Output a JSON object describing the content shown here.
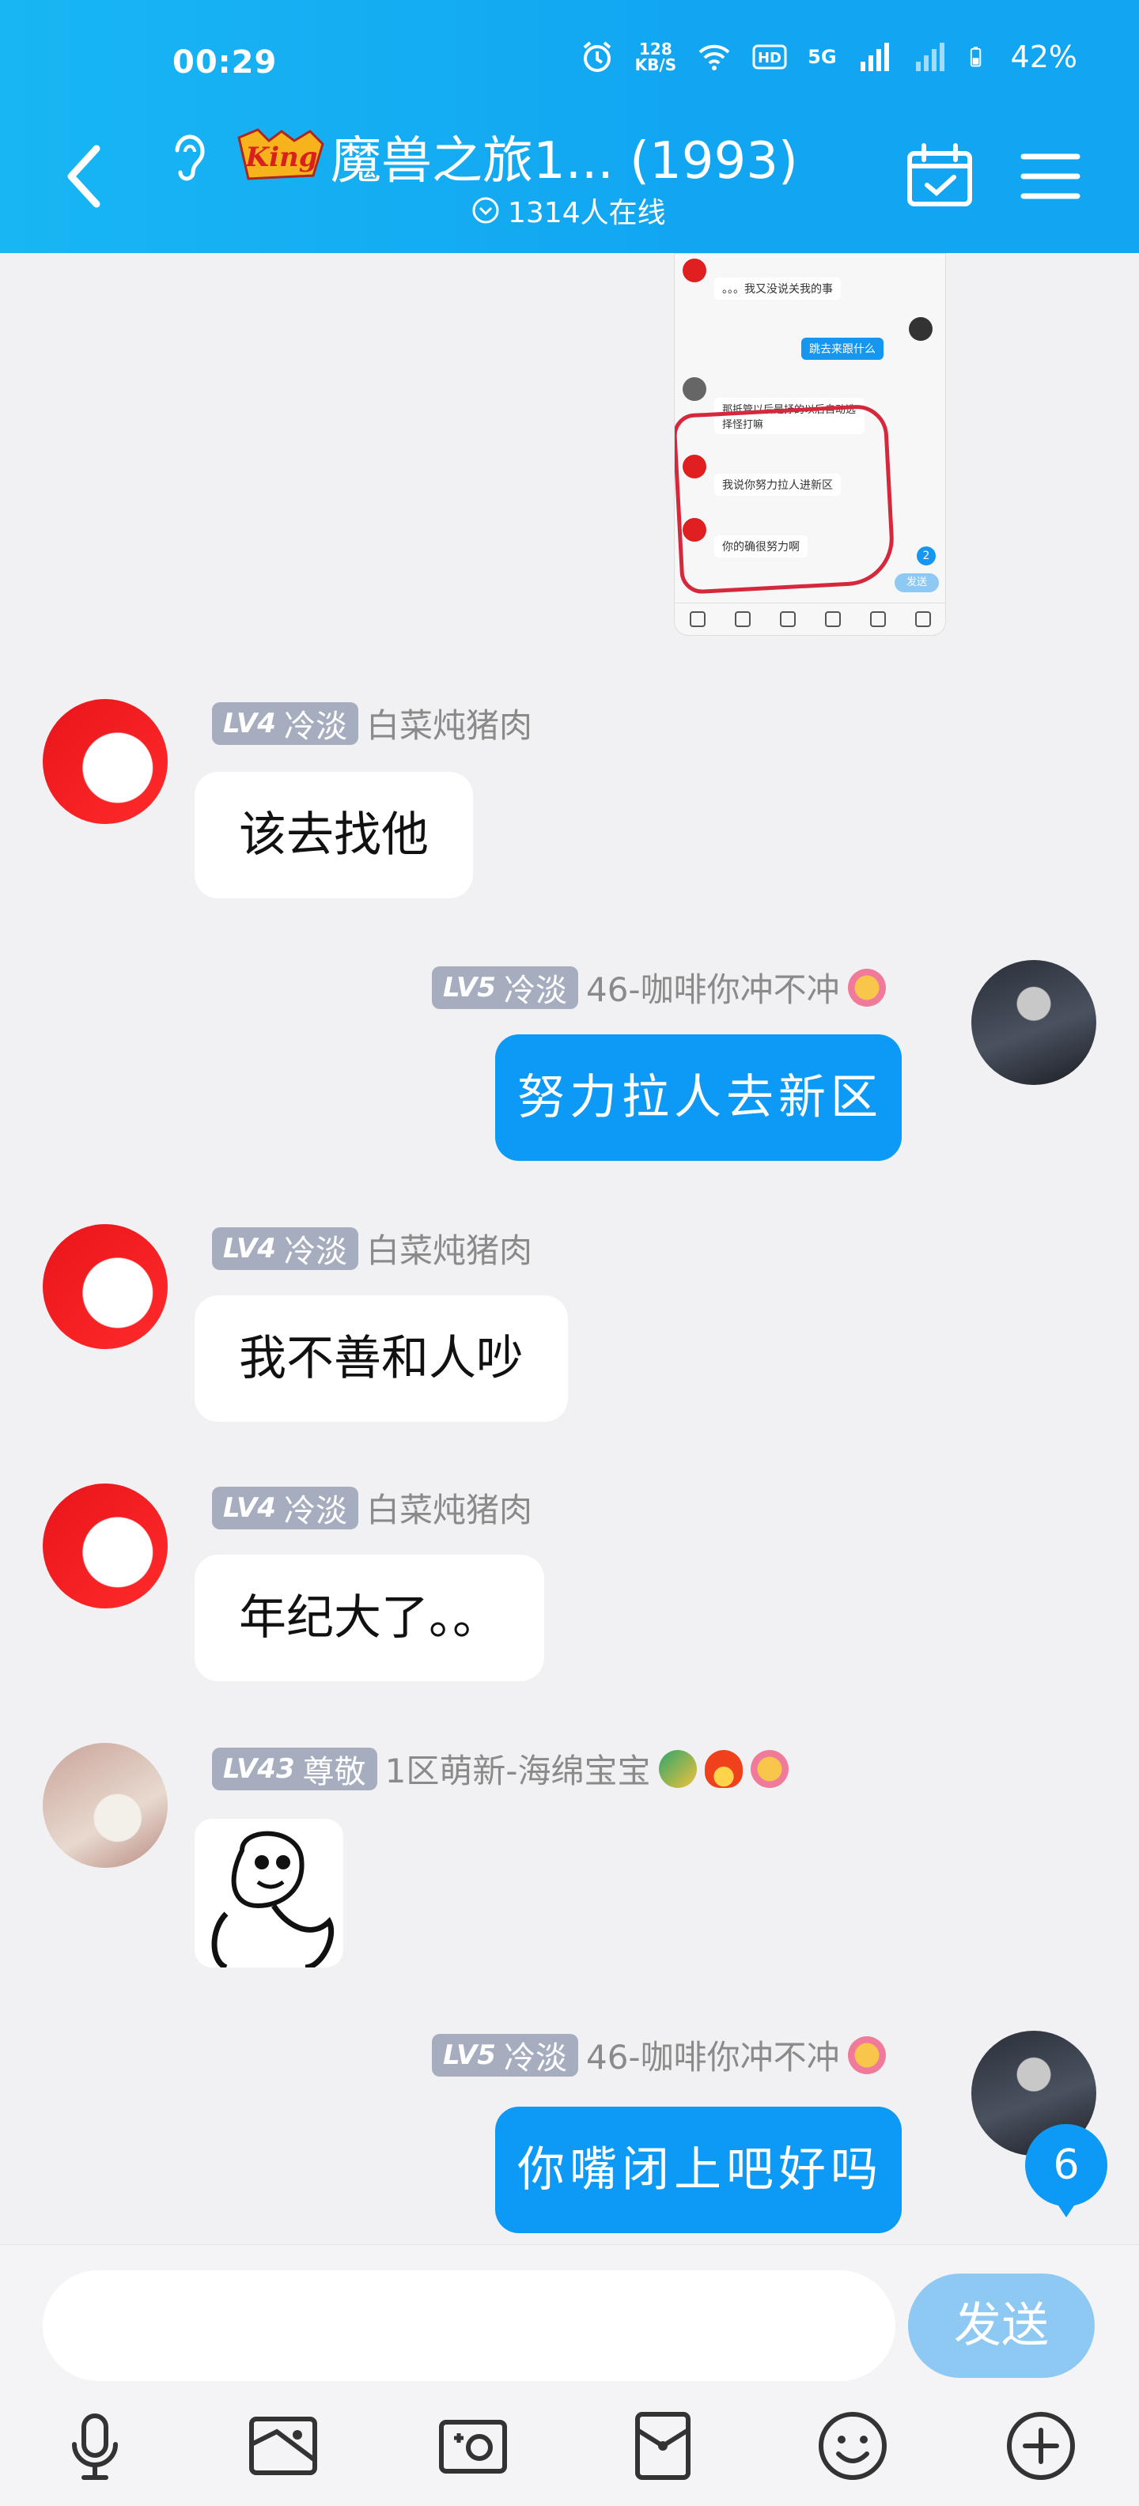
{
  "status": {
    "time": "00:29",
    "netspeed_value": "128",
    "netspeed_unit": "KB/S",
    "network": "5G",
    "battery": "42%"
  },
  "header": {
    "title": "魔兽之旅1... (1993)",
    "online": "1314人在线"
  },
  "thumbnail": {
    "lines": [
      "。。。我又没说关我的事",
      "跳去来跟什么",
      "那抵管以后是抒的以后自动选择怪打嘛",
      "我说你努力拉人进新区",
      "你的确很努力啊"
    ],
    "send_label": "发送",
    "unread": "2"
  },
  "messages": [
    {
      "level": "LV4",
      "title": "冷淡",
      "nick": "白菜炖猪肉",
      "text": "该去找他"
    },
    {
      "level": "LV5",
      "title": "冷淡",
      "nick": "46-咖啡你冲不冲",
      "text": "努力拉人去新区"
    },
    {
      "level": "LV4",
      "title": "冷淡",
      "nick": "白菜炖猪肉",
      "text": "我不善和人吵"
    },
    {
      "level": "LV4",
      "title": "冷淡",
      "nick": "白菜炖猪肉",
      "text": "年纪大了。。"
    },
    {
      "level": "LV43",
      "title": "尊敬",
      "nick": "1区萌新-海绵宝宝",
      "text": ""
    },
    {
      "level": "LV5",
      "title": "冷淡",
      "nick": "46-咖啡你冲不冲",
      "text": "你嘴闭上吧好吗"
    }
  ],
  "unread_badge": "6",
  "composer": {
    "placeholder": "",
    "send_label": "发送"
  },
  "colors": {
    "header": "#12a6f2",
    "accent": "#0d9af6",
    "level_badge": "#a6adbf"
  }
}
